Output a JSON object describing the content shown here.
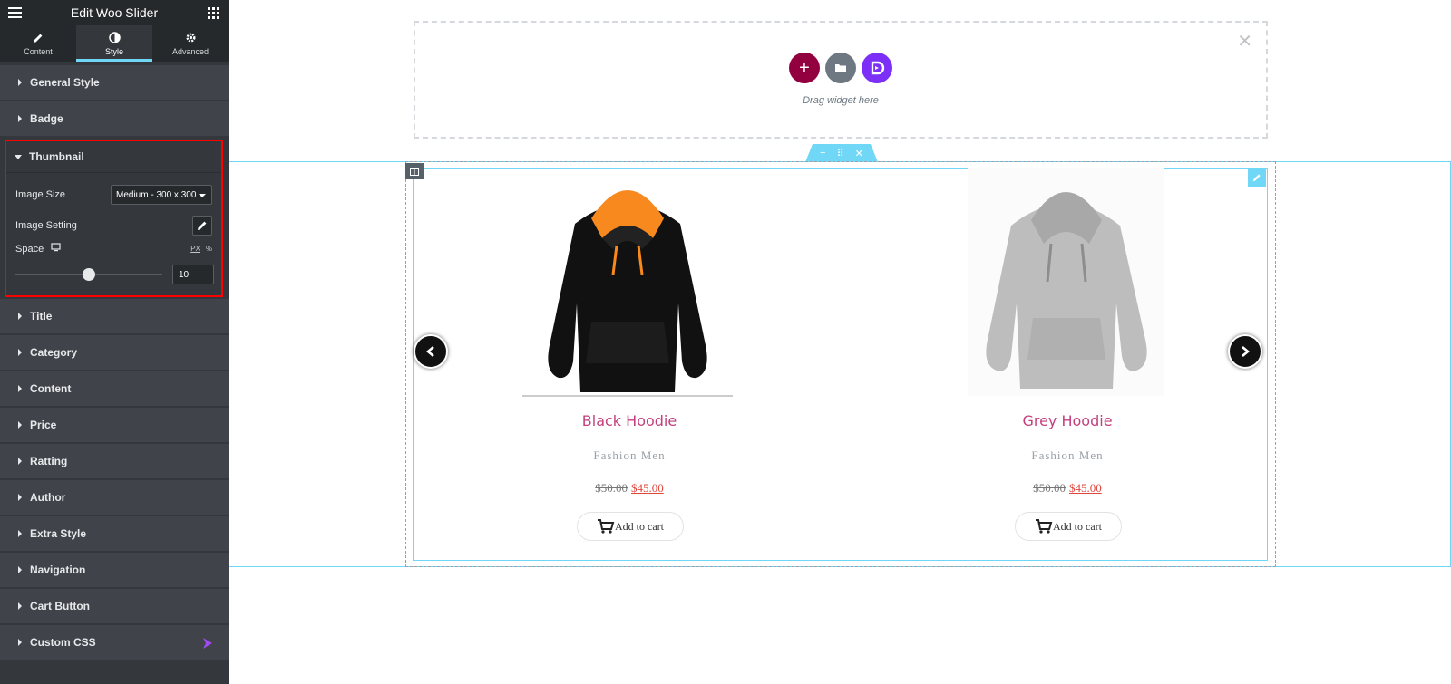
{
  "sidebar": {
    "title": "Edit Woo Slider",
    "tabs": [
      {
        "label": "Content",
        "icon": "pencil-icon"
      },
      {
        "label": "Style",
        "icon": "half-circle-icon"
      },
      {
        "label": "Advanced",
        "icon": "gear-icon"
      }
    ],
    "sections_top": [
      "General Style",
      "Badge"
    ],
    "thumbnail": {
      "label": "Thumbnail",
      "image_size_label": "Image Size",
      "image_size_value": "Medium - 300 x 300",
      "image_setting_label": "Image Setting",
      "space_label": "Space",
      "unit_px": "PX",
      "unit_percent": "%",
      "space_value": "10",
      "space_slider_fraction": 0.5
    },
    "sections_bottom": [
      "Title",
      "Category",
      "Content",
      "Price",
      "Ratting",
      "Author",
      "Extra Style",
      "Navigation",
      "Cart Button",
      "Custom CSS"
    ]
  },
  "canvas": {
    "drag_text": "Drag widget here",
    "products": [
      {
        "name": "Black Hoodie",
        "category": "Fashion Men",
        "old_price": "$50.00",
        "price": "$45.00",
        "cart_label": "Add to cart"
      },
      {
        "name": "Grey Hoodie",
        "category": "Fashion Men",
        "old_price": "$50.00",
        "price": "$45.00",
        "cart_label": "Add to cart"
      }
    ]
  },
  "colors": {
    "accent": "#71d7f7",
    "panel": "#34383c",
    "highlight": "#ff0000",
    "product_name": "#c3407d",
    "sale_price": "#e0463c",
    "add_button": "#93003f",
    "folder_button": "#6d7882",
    "brand_button": "#7b2ff7"
  }
}
